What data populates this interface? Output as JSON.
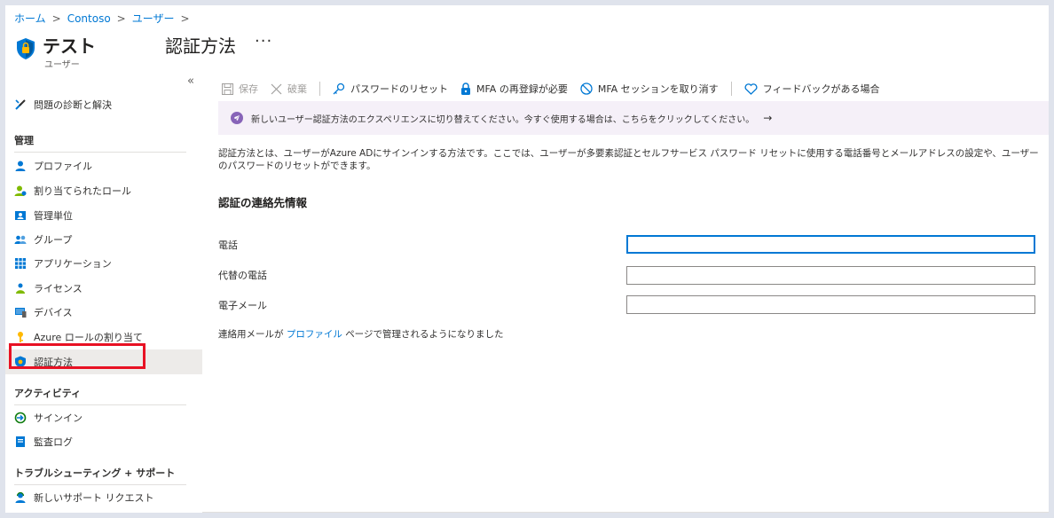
{
  "breadcrumb": [
    "ホーム",
    "Contoso",
    "ユーザー"
  ],
  "header": {
    "title": "テスト",
    "subtitle": "ユーザー",
    "page_title": "認証方法",
    "more": "···"
  },
  "sidebar": {
    "collapse": "«",
    "diagnose": "問題の診断と解決",
    "group_manage": "管理",
    "manage_items": [
      {
        "label": "プロファイル",
        "icon": "user-icon"
      },
      {
        "label": "割り当てられたロール",
        "icon": "role-icon"
      },
      {
        "label": "管理単位",
        "icon": "admin-unit-icon"
      },
      {
        "label": "グループ",
        "icon": "group-icon"
      },
      {
        "label": "アプリケーション",
        "icon": "apps-grid-icon"
      },
      {
        "label": "ライセンス",
        "icon": "license-icon"
      },
      {
        "label": "デバイス",
        "icon": "device-icon"
      },
      {
        "label": "Azure ロールの割り当て",
        "icon": "key-icon"
      },
      {
        "label": "認証方法",
        "icon": "shield-icon"
      }
    ],
    "group_activity": "アクティビティ",
    "activity_items": [
      {
        "label": "サインイン",
        "icon": "signin-icon"
      },
      {
        "label": "監査ログ",
        "icon": "audit-log-icon"
      }
    ],
    "group_support": "トラブルシューティング + サポート",
    "support_items": [
      {
        "label": "新しいサポート リクエスト",
        "icon": "support-icon"
      }
    ]
  },
  "toolbar": {
    "save": "保存",
    "discard": "破棄",
    "reset_password": "パスワードのリセット",
    "require_mfa": "MFA の再登録が必要",
    "revoke_mfa": "MFA セッションを取り消す",
    "feedback": "フィードバックがある場合"
  },
  "banner": {
    "text": "新しいユーザー認証方法のエクスペリエンスに切り替えてください。今すぐ使用する場合は、こちらをクリックしてください。",
    "arrow": "→"
  },
  "main": {
    "description": "認証方法とは、ユーザーがAzure ADにサインインする方法です。ここでは、ユーザーが多要素認証とセルフサービス パスワード リセットに使用する電話番号とメールアドレスの設定や、ユーザーのパスワードのリセットができます。",
    "section_title": "認証の連絡先情報",
    "fields": [
      {
        "label": "電話",
        "value": ""
      },
      {
        "label": "代替の電話",
        "value": ""
      },
      {
        "label": "電子メール",
        "value": ""
      }
    ],
    "note_before": "連絡用メールが",
    "note_link": "プロファイル",
    "note_after": "ページで管理されるようになりました"
  },
  "colors": {
    "accent": "#0078d4",
    "banner_bg": "#f5f0f8",
    "banner_icon": "#8764b8",
    "highlight": "#e81123"
  }
}
